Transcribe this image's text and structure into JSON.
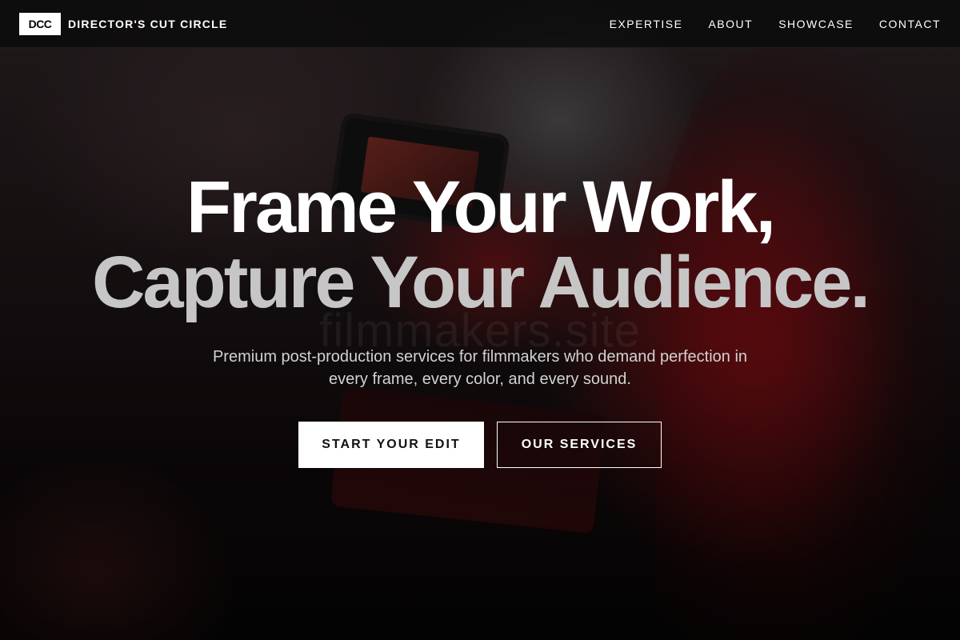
{
  "nav": {
    "logo_text": "DCC",
    "brand_name": "DIRECTOR'S CUT CIRCLE",
    "links": [
      {
        "label": "EXPERTISE"
      },
      {
        "label": "ABOUT"
      },
      {
        "label": "SHOWCASE"
      },
      {
        "label": "CONTACT"
      }
    ]
  },
  "hero": {
    "headline_line1": "Frame Your Work,",
    "headline_line2": "Capture Your Audience.",
    "watermark": "filmmakers.site",
    "subtitle": "Premium post-production services for filmmakers who demand perfection in every frame, every color, and every sound.",
    "primary_cta": "START YOUR EDIT",
    "secondary_cta": "OUR SERVICES"
  },
  "colors": {
    "nav_background": "#0a0a0a",
    "primary_button": "#ffffff",
    "headline_primary": "#ffffff",
    "headline_secondary": "#c6c6c6",
    "accent_red": "#8c0e14"
  }
}
